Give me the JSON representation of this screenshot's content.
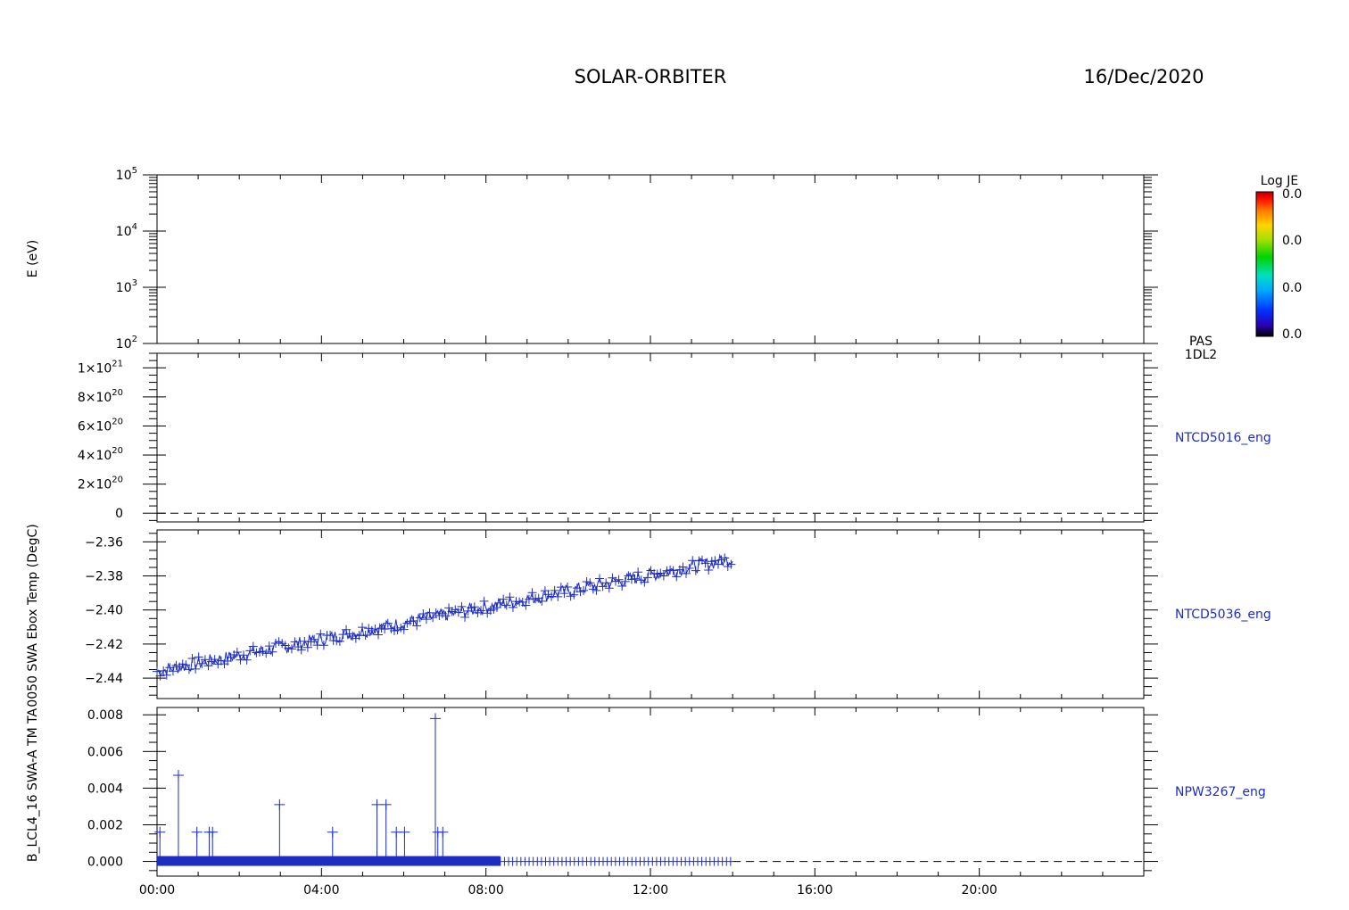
{
  "header": {
    "title": "SOLAR-ORBITER",
    "date": "16/Dec/2020"
  },
  "colorbar": {
    "title": "Log JE",
    "labels": [
      "0.0",
      "0.0",
      "0.0",
      "0.0"
    ],
    "colors": [
      "#000000",
      "#2a00b8",
      "#0033ff",
      "#00aaff",
      "#00e0c0",
      "#00d400",
      "#a8e000",
      "#ffd400",
      "#ff7a00",
      "#ff0000",
      "#b00000"
    ]
  },
  "colors": {
    "frame": "#000000",
    "series": "#1d2cc2"
  },
  "chart_data": [
    {
      "type": "heatmap",
      "ylabel": "E (eV)",
      "scale": "log",
      "ylim": [
        100,
        100000
      ],
      "yticks": [
        {
          "value": 100000,
          "base": "10",
          "exp": "5"
        },
        {
          "value": 10000,
          "base": "10",
          "exp": "4"
        },
        {
          "value": 1000,
          "base": "10",
          "exp": "3"
        },
        {
          "value": 100,
          "base": "10",
          "exp": "2"
        }
      ],
      "right_label": [
        "PAS",
        "1DL2"
      ],
      "data": []
    },
    {
      "type": "line",
      "ylabel": "",
      "ylim": [
        -6e+19,
        1.1e+21
      ],
      "yticks": [
        {
          "value": 1e+21,
          "mant": "1×10",
          "exp": "21"
        },
        {
          "value": 8e+20,
          "mant": "8×10",
          "exp": "20"
        },
        {
          "value": 6e+20,
          "mant": "6×10",
          "exp": "20"
        },
        {
          "value": 4e+20,
          "mant": "4×10",
          "exp": "20"
        },
        {
          "value": 2e+20,
          "mant": "2×10",
          "exp": "20"
        },
        {
          "value": 0,
          "mant": "0",
          "exp": ""
        }
      ],
      "right_label": "NTCD5016_eng",
      "zero_line": true,
      "data": []
    },
    {
      "type": "scatter",
      "ylabel": "0050 SWA Ebox Temp (DegC)",
      "ylim": [
        -2.452,
        -2.353
      ],
      "yticks": [
        {
          "value": -2.36,
          "label": "−2.36"
        },
        {
          "value": -2.38,
          "label": "−2.38"
        },
        {
          "value": -2.4,
          "label": "−2.40"
        },
        {
          "value": -2.42,
          "label": "−2.42"
        },
        {
          "value": -2.44,
          "label": "−2.44"
        }
      ],
      "right_label": "NTCD5036_eng",
      "trend": {
        "start_hour": 0.0,
        "end_hour": 14.0,
        "start": -2.436,
        "end": -2.37,
        "scatter": 0.004,
        "points": 360
      }
    },
    {
      "type": "scatter",
      "ylabel": "B_LCL4_16 SWA-A TM TA",
      "ylim": [
        -0.0008,
        0.0084
      ],
      "yticks": [
        {
          "value": 0.008,
          "label": "0.008"
        },
        {
          "value": 0.006,
          "label": "0.006"
        },
        {
          "value": 0.004,
          "label": "0.004"
        },
        {
          "value": 0.002,
          "label": "0.002"
        },
        {
          "value": 0.0,
          "label": "0.000"
        }
      ],
      "right_label": "NPW3267_eng",
      "zero_line": true,
      "dense_until_hour": 8.35,
      "sparse_until_hour": 14.0,
      "spikes": [
        {
          "hour": 0.07,
          "value": 0.0016
        },
        {
          "hour": 0.52,
          "value": 0.0047
        },
        {
          "hour": 0.97,
          "value": 0.0016
        },
        {
          "hour": 1.27,
          "value": 0.0016
        },
        {
          "hour": 1.35,
          "value": 0.0016
        },
        {
          "hour": 2.98,
          "value": 0.0031
        },
        {
          "hour": 4.27,
          "value": 0.0016
        },
        {
          "hour": 5.35,
          "value": 0.0031
        },
        {
          "hour": 5.57,
          "value": 0.0031
        },
        {
          "hour": 5.82,
          "value": 0.0016
        },
        {
          "hour": 6.02,
          "value": 0.0016
        },
        {
          "hour": 6.77,
          "value": 0.0078
        },
        {
          "hour": 6.83,
          "value": 0.0016
        },
        {
          "hour": 6.95,
          "value": 0.0016
        }
      ]
    }
  ],
  "xaxis": {
    "xlim": [
      0,
      24
    ],
    "ticks": [
      {
        "hour": 0,
        "label": "00:00"
      },
      {
        "hour": 4,
        "label": "04:00"
      },
      {
        "hour": 8,
        "label": "08:00"
      },
      {
        "hour": 12,
        "label": "12:00"
      },
      {
        "hour": 16,
        "label": "16:00"
      },
      {
        "hour": 20,
        "label": "20:00"
      }
    ]
  }
}
